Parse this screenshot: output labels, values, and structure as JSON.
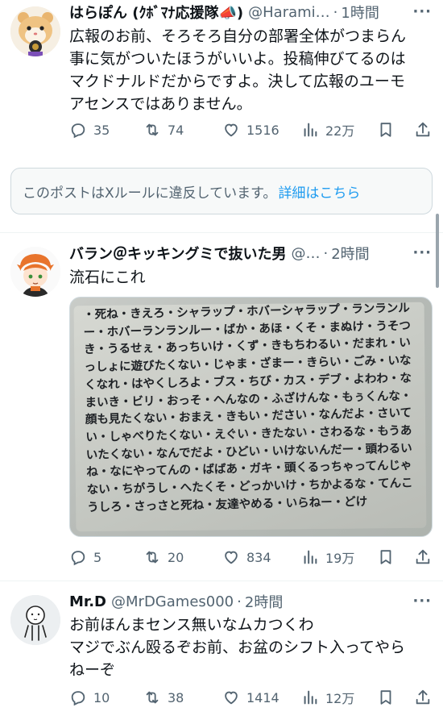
{
  "posts": [
    {
      "name": "はらぽん (ｸﾎﾞﾏﾅ応援隊📣)",
      "handle": "@Harami…",
      "time": "1時間",
      "text": "広報のお前、そろそろ自分の部署全体がつまらん\n事に気がついたほうがいいよ。投稿伸びてるのは\nマクドナルドだからですよ。決して広報のユーモ\nアセンスではありません。",
      "replies": "35",
      "reposts": "74",
      "likes": "1516",
      "views": "22万"
    },
    {
      "name": "バラン＠キッキングミで抜いた男",
      "handle": "@…",
      "time": "2時間",
      "text": "流石にこれ",
      "replies": "5",
      "reposts": "20",
      "likes": "834",
      "views": "19万"
    },
    {
      "name": "Mr.D",
      "handle": "@MrDGames000",
      "time": "2時間",
      "text": "お前ほんまセンス無いなムカつくわ\nマジでぶん殴るぞお前、お盆のシフト入ってやら\nねーぞ",
      "replies": "10",
      "reposts": "38",
      "likes": "1414",
      "views": "12万"
    }
  ],
  "notice": {
    "text": "このポストはXルールに違反しています。",
    "link": "詳細はこちら"
  },
  "photo_lines": [
    "・死ね・きえろ・シャラップ・ホバーシャラップ・ランランル",
    "ー・ホバーランランルー・ばか・あほ・くそ・まぬけ・うそつ",
    "き・うるせぇ・あっちいけ・くず・きもちわるい・だまれ・い",
    "っしょに遊びたくない・じゃま・ざまー・きらい・ごみ・いな",
    "くなれ・はやくしろよ・ブス・ちび・カス・デブ・よわわ・な",
    "まいき・ビリ・おっそ・へんなの・ふざけんな・もぅくんな・",
    "顔も見たくない・おまえ・きもい・ださい・なんだよ・さいて",
    "い・しゃべりたくない・えぐい・きたない・さわるな・もうあ",
    "いたくない・なんでだよ・ひどい・いけないんだー・頭わるい",
    "ね・なにやってんの・ばばあ・ガキ・頭くるっちゃってんじゃ",
    "ない・ちがうし・へたくそ・どっかいけ・ちかよるな・てんこ",
    "うしろ・さっさと死ね・友達やめる・いらねー・どけ"
  ],
  "colors": {
    "secondary_text": "#536471",
    "link": "#1d9bf0",
    "border": "#cfd9de"
  },
  "icons": [
    "reply-icon",
    "repost-icon",
    "like-icon",
    "views-icon",
    "bookmark-icon",
    "share-icon",
    "more-icon"
  ]
}
